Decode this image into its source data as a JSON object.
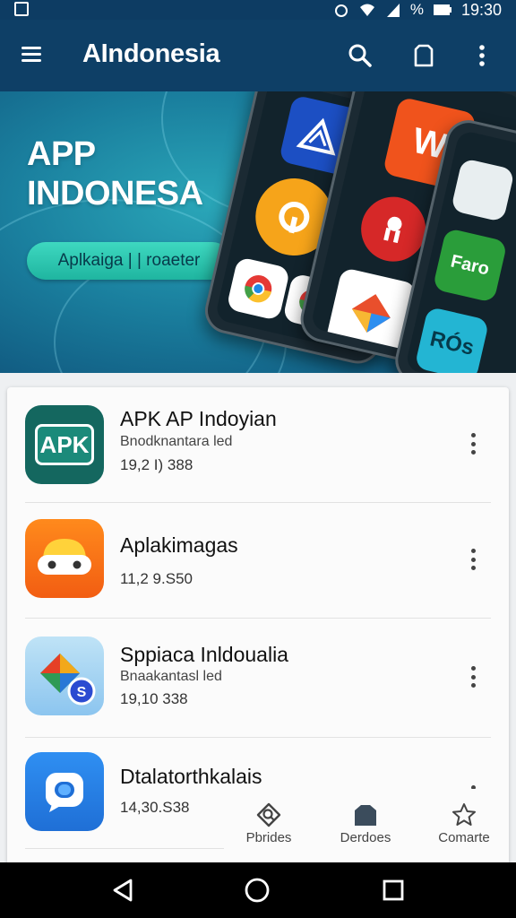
{
  "status_bar": {
    "percent_symbol": "%",
    "time": "19:30"
  },
  "app_bar": {
    "title": "AIndonesia",
    "icons": [
      "menu-icon",
      "search-icon",
      "bookmark-icon",
      "more-vert-icon"
    ]
  },
  "banner": {
    "title_line1": "APP",
    "title_line2": "INDONESA",
    "button_label": "Aplkaiga | | roaeter",
    "tile_labels": [
      "W",
      "Faro",
      "RÓs"
    ]
  },
  "apps": [
    {
      "name": "APK AP Indoyian",
      "subtitle": "Bnodknantara led",
      "meta": "19,2 I) 388",
      "icon": "apk-icon",
      "icon_text": "APK"
    },
    {
      "name": "Aplakimagas",
      "subtitle": "",
      "meta": "11,2 9.S50",
      "icon": "robot-face-icon",
      "icon_text": ""
    },
    {
      "name": "Sppiaca Inldoualia",
      "subtitle": "Bnaakantasl led",
      "meta": "19,10 338",
      "icon": "maps-icon",
      "icon_text": ""
    },
    {
      "name": "Dtalatorthkalais",
      "subtitle": "",
      "meta": "14,30.S38",
      "icon": "chat-icon",
      "icon_text": ""
    }
  ],
  "bottom_nav": [
    {
      "label": "Pbrides",
      "icon": "discover-icon"
    },
    {
      "label": "Derdoes",
      "icon": "tag-icon"
    },
    {
      "label": "Comarte",
      "icon": "star-icon"
    }
  ],
  "system_nav": [
    "back-icon",
    "home-icon",
    "recents-icon"
  ],
  "colors": {
    "app_bar": "#0e3f66",
    "accent": "#1fb5a0",
    "card_bg": "#fbfbfb"
  }
}
